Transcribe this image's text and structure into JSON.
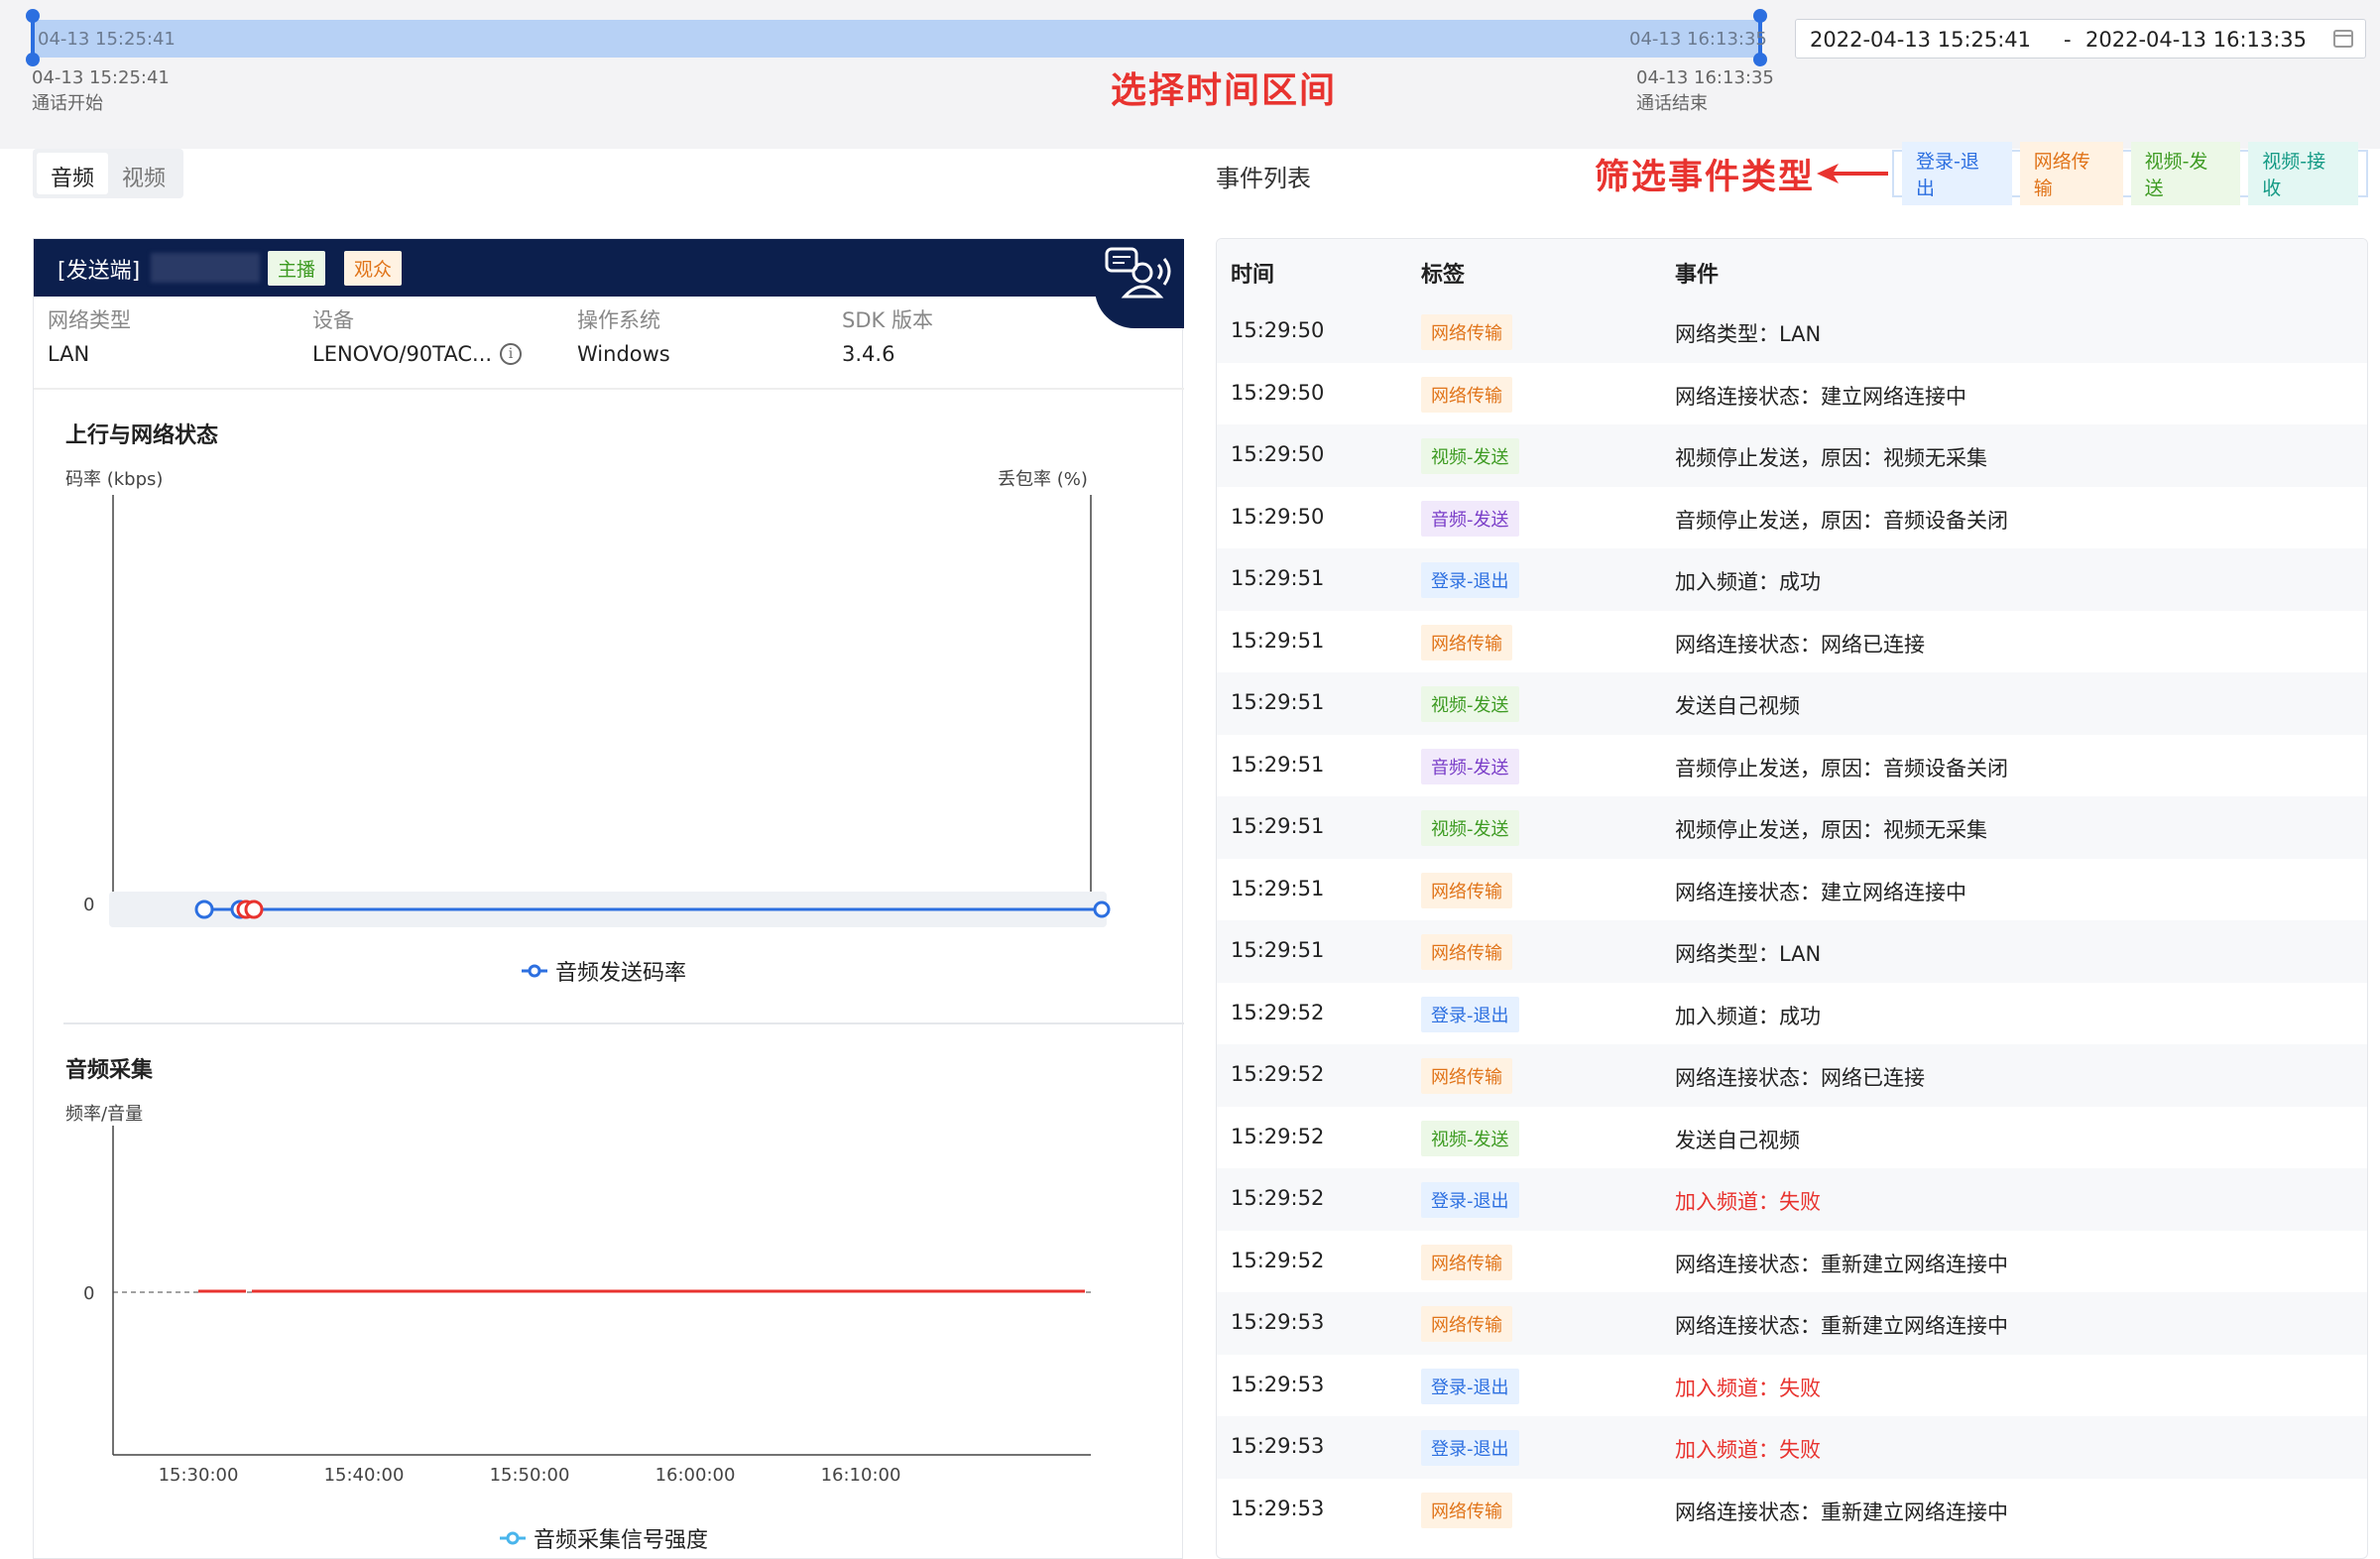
{
  "timeline": {
    "inner_start": "04-13 15:25:41",
    "inner_end": "04-13 16:13:35",
    "start_time": "04-13 15:25:41",
    "start_caption": "通话开始",
    "end_time": "04-13 16:13:35",
    "end_caption": "通话结束",
    "annotation": "选择时间区间"
  },
  "date_range": {
    "start": "2022-04-13 15:25:41",
    "separator": "-",
    "end": "2022-04-13 16:13:35"
  },
  "media_tabs": {
    "audio": "音频",
    "video": "视频"
  },
  "event_list_title": "事件列表",
  "filter": {
    "annotation": "筛选事件类型",
    "chips": [
      "登录-退出",
      "网络传输",
      "视频-发送",
      "视频-接收"
    ]
  },
  "sender": {
    "label": "[发送端]",
    "role_host": "主播",
    "role_audience": "观众",
    "info": [
      {
        "key": "网络类型",
        "value": "LAN"
      },
      {
        "key": "设备",
        "value": "LENOVO/90TAC..."
      },
      {
        "key": "操作系统",
        "value": "Windows"
      },
      {
        "key": "SDK 版本",
        "value": "3.4.6"
      }
    ],
    "info_icon": "i"
  },
  "uplink_chart": {
    "title": "上行与网络状态",
    "ylabel_left": "码率 (kbps)",
    "ylabel_right": "丢包率 (%)",
    "y_zero": "0",
    "x_ticks": [
      "15:30:00",
      "15:40:00",
      "15:50:00",
      "16:00:00",
      "16:10:00"
    ],
    "legend": "音频发送码率"
  },
  "capture_chart": {
    "title": "音频采集",
    "ylabel_left": "频率/音量",
    "y_zero": "0",
    "x_ticks": [
      "15:30:00",
      "15:40:00",
      "15:50:00",
      "16:00:00",
      "16:10:00"
    ],
    "legend": "音频采集信号强度"
  },
  "events": {
    "headers": {
      "time": "时间",
      "tag": "标签",
      "event": "事件"
    },
    "rows": [
      {
        "time": "15:29:50",
        "tag": "网络传输",
        "text": "网络类型：LAN"
      },
      {
        "time": "15:29:50",
        "tag": "网络传输",
        "text": "网络连接状态：建立网络连接中"
      },
      {
        "time": "15:29:50",
        "tag": "视频-发送",
        "text": "视频停止发送，原因：视频无采集"
      },
      {
        "time": "15:29:50",
        "tag": "音频-发送",
        "text": "音频停止发送，原因：音频设备关闭"
      },
      {
        "time": "15:29:51",
        "tag": "登录-退出",
        "text": "加入频道：成功"
      },
      {
        "time": "15:29:51",
        "tag": "网络传输",
        "text": "网络连接状态：网络已连接"
      },
      {
        "time": "15:29:51",
        "tag": "视频-发送",
        "text": "发送自己视频"
      },
      {
        "time": "15:29:51",
        "tag": "音频-发送",
        "text": "音频停止发送，原因：音频设备关闭"
      },
      {
        "time": "15:29:51",
        "tag": "视频-发送",
        "text": "视频停止发送，原因：视频无采集"
      },
      {
        "time": "15:29:51",
        "tag": "网络传输",
        "text": "网络连接状态：建立网络连接中"
      },
      {
        "time": "15:29:51",
        "tag": "网络传输",
        "text": "网络类型：LAN"
      },
      {
        "time": "15:29:52",
        "tag": "登录-退出",
        "text": "加入频道：成功"
      },
      {
        "time": "15:29:52",
        "tag": "网络传输",
        "text": "网络连接状态：网络已连接"
      },
      {
        "time": "15:29:52",
        "tag": "视频-发送",
        "text": "发送自己视频"
      },
      {
        "time": "15:29:52",
        "tag": "登录-退出",
        "text": "加入频道：失败",
        "error": true
      },
      {
        "time": "15:29:52",
        "tag": "网络传输",
        "text": "网络连接状态：重新建立网络连接中"
      },
      {
        "time": "15:29:53",
        "tag": "网络传输",
        "text": "网络连接状态：重新建立网络连接中"
      },
      {
        "time": "15:29:53",
        "tag": "登录-退出",
        "text": "加入频道：失败",
        "error": true
      },
      {
        "time": "15:29:53",
        "tag": "登录-退出",
        "text": "加入频道：失败",
        "error": true
      },
      {
        "time": "15:29:53",
        "tag": "网络传输",
        "text": "网络连接状态：重新建立网络连接中"
      }
    ]
  },
  "colors": {
    "accent_red": "#e8332f",
    "header_navy": "#0c1f4d",
    "line_blue": "#2c6fe0",
    "line_red": "#e8332f"
  }
}
